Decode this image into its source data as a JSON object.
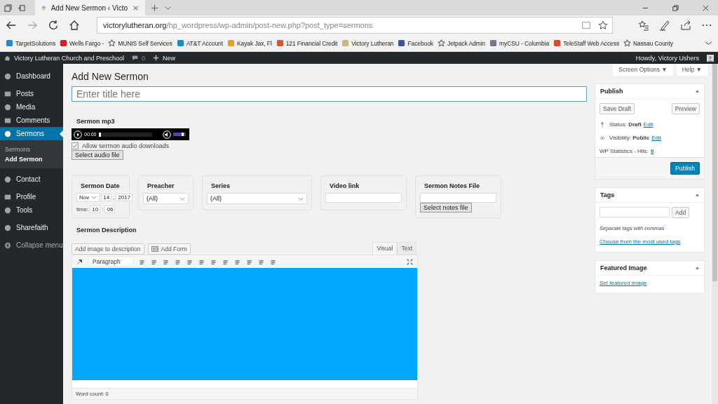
{
  "browser": {
    "tab": {
      "title": "Add New Sermon ‹ Victo"
    },
    "address": {
      "host": "victorylutheran.org",
      "path": "/hp_wordpress/wp-admin/post-new.php?post_type=sermons"
    },
    "bookmarks": [
      {
        "label": "TargetSolutions",
        "kind": "site",
        "color": "#1e88e5"
      },
      {
        "label": "Wells Fargo -",
        "kind": "site",
        "color": "#d71e28"
      },
      {
        "label": "MUNIS Self Services",
        "kind": "star"
      },
      {
        "label": "AT&T Account",
        "kind": "site",
        "color": "#0a8fd6"
      },
      {
        "label": "Kayak Jax, Fl",
        "kind": "site",
        "color": "#e6a11a"
      },
      {
        "label": "121 Financial Credit",
        "kind": "site",
        "color": "#e8502a"
      },
      {
        "label": "Victory Lutheran",
        "kind": "site",
        "color": "#c9b78a"
      },
      {
        "label": "Facebook",
        "kind": "site",
        "color": "#3b5998"
      },
      {
        "label": "Jetpack Admin",
        "kind": "star"
      },
      {
        "label": "myCSU - Columbia",
        "kind": "site",
        "color": "#6b7c8f"
      },
      {
        "label": "TeleStaff Web Access",
        "kind": "site",
        "color": "#e2452b"
      },
      {
        "label": "Nassau County",
        "kind": "star"
      }
    ]
  },
  "admin_bar": {
    "site": "Victory Lutheran Church and Preschool",
    "comments": "0",
    "new": "New",
    "howdy": "Howdy, Victory Ushers"
  },
  "sidebar": {
    "groups": [
      [
        {
          "label": "Dashboard",
          "selected": false
        }
      ],
      [
        {
          "label": "Posts",
          "selected": false
        },
        {
          "label": "Media",
          "selected": false
        },
        {
          "label": "Comments",
          "selected": false
        },
        {
          "label": "Sermons",
          "selected": true,
          "children": [
            {
              "label": "Sermons",
              "selected": false
            },
            {
              "label": "Add Sermon",
              "selected": true
            }
          ]
        }
      ],
      [
        {
          "label": "Contact",
          "selected": false
        }
      ],
      [
        {
          "label": "Profile",
          "selected": false
        },
        {
          "label": "Tools",
          "selected": false
        }
      ],
      [
        {
          "label": "Sharefaith",
          "selected": false
        }
      ]
    ],
    "collapse": "Collapse menu"
  },
  "page": {
    "heading": "Add New Sermon",
    "screen_options": "Screen Options ▼",
    "help": "Help ▼",
    "title_placeholder": "Enter title here"
  },
  "mp3": {
    "label": "Sermon mp3",
    "time": "00:00",
    "progress": {
      "level": 0
    },
    "volume": {
      "level": 0.85
    },
    "allow_downloads": {
      "label": "Allow sermon audio downloads",
      "checked": true
    },
    "select_button": "Select audio file"
  },
  "fields": [
    {
      "kind": "date",
      "label": "Sermon Date",
      "month": "Nov",
      "day": "14",
      "comma": ",",
      "year": "2017",
      "time_label": "time:",
      "hour": "10",
      "colon": ":",
      "minute": "06"
    },
    {
      "kind": "select",
      "label": "Preacher",
      "value": "(All)"
    },
    {
      "kind": "select",
      "label": "Series",
      "value": "(All)"
    },
    {
      "kind": "text",
      "label": "Video link"
    },
    {
      "kind": "file",
      "label": "Sermon Notes File",
      "button": "Select notes file"
    }
  ],
  "description": {
    "label": "Sermon Description",
    "add_image": "Add image to description",
    "add_form": "Add Form",
    "tabs": [
      {
        "label": "Visual",
        "selected": true
      },
      {
        "label": "Text",
        "selected": false
      }
    ],
    "format": "Paragraph",
    "word_count": "Word count: 0"
  },
  "publish": {
    "title": "Publish",
    "save_draft": "Save Draft",
    "preview": "Preview",
    "status_label": "Status:",
    "status": "Draft",
    "status_edit": "Edit",
    "visibility_label": "Visibility:",
    "visibility": "Public",
    "visibility_edit": "Edit",
    "stats_label": "WP Statistics - Hits:",
    "stats": "0",
    "button": "Publish"
  },
  "tags": {
    "title": "Tags",
    "add": "Add",
    "hint": "Separate tags with commas",
    "link": "Choose from the most used tags"
  },
  "featured": {
    "title": "Featured Image",
    "link": "Set featured image"
  }
}
